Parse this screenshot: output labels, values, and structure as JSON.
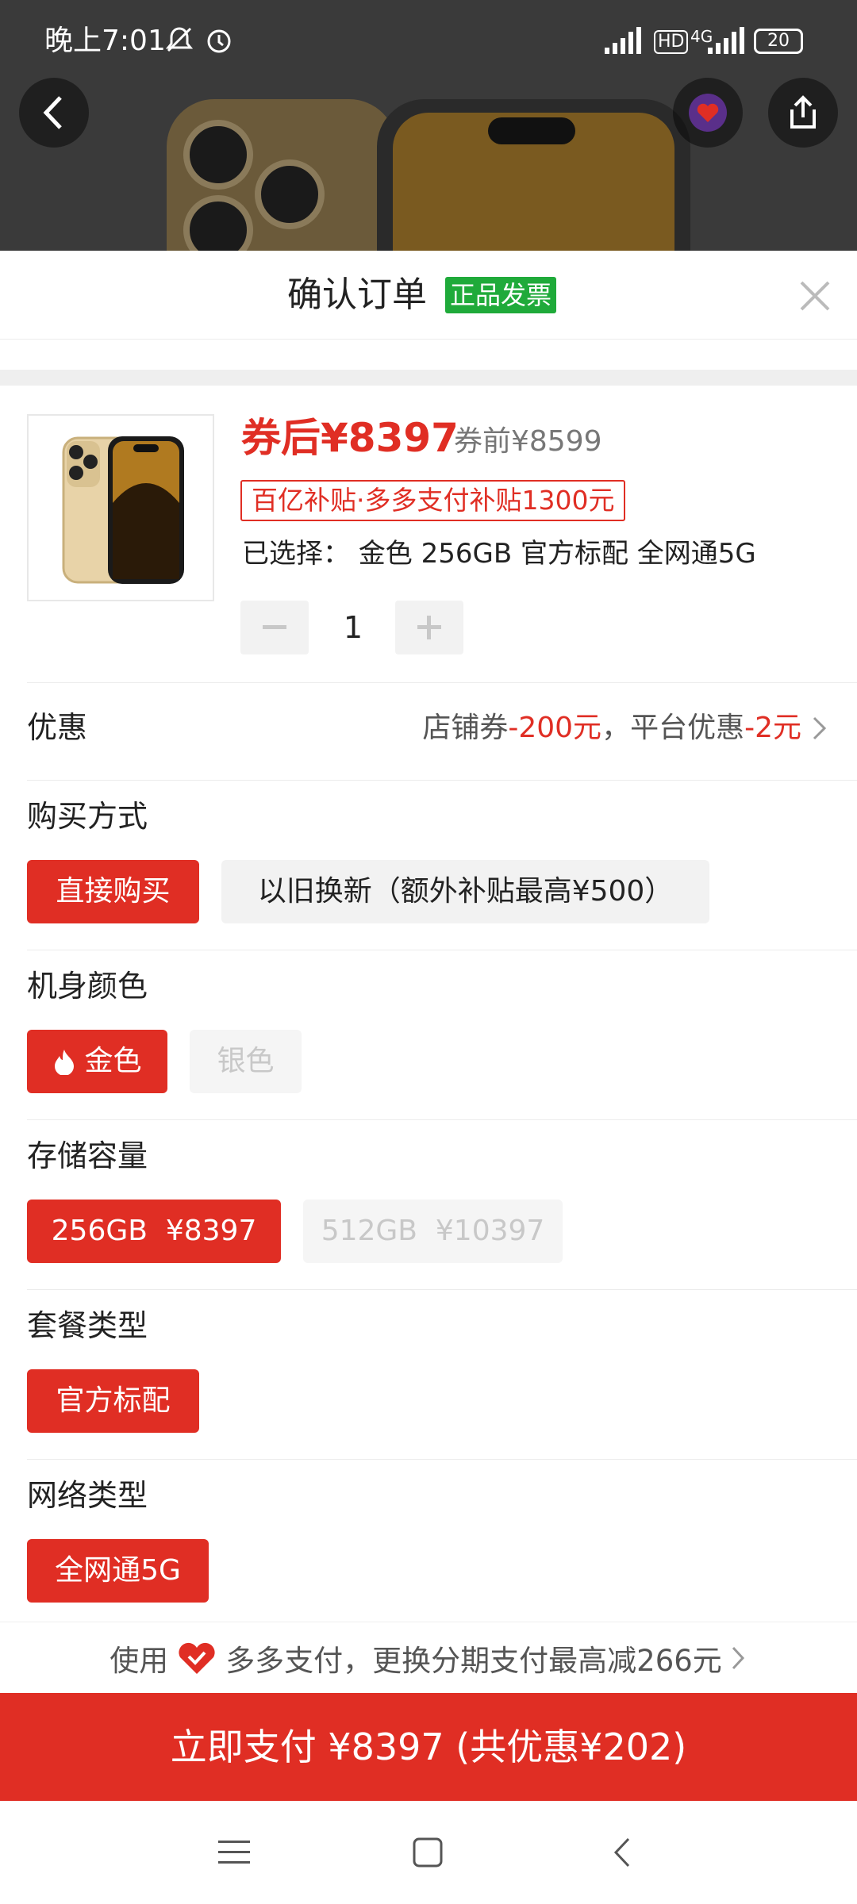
{
  "status_bar": {
    "time": "晚上7:01",
    "network": "4G",
    "hd": "HD",
    "battery": "20"
  },
  "header": {
    "title": "确认订单",
    "badge": "正品发票"
  },
  "product": {
    "price_after": "券后¥8397",
    "price_before": "券前¥8599",
    "subsidy_tag": "百亿补贴·多多支付补贴1300元",
    "selected": "已选择：  金色 256GB 官方标配 全网通5G",
    "quantity": "1"
  },
  "discount": {
    "label": "优惠",
    "shop_coupon_label": "店铺券",
    "shop_coupon_value": "-200元",
    "separator": "，",
    "platform_label": "平台优惠",
    "platform_value": "-2元"
  },
  "sections": {
    "purchase_method": {
      "title": "购买方式",
      "options": [
        "直接购买",
        "以旧换新（额外补贴最高¥500）"
      ]
    },
    "color": {
      "title": "机身颜色",
      "options": [
        "金色",
        "银色"
      ]
    },
    "storage": {
      "title": "存储容量",
      "options": [
        "256GB  ¥8397",
        "512GB  ¥10397"
      ]
    },
    "package": {
      "title": "套餐类型",
      "options": [
        "官方标配"
      ]
    },
    "network": {
      "title": "网络类型",
      "options": [
        "全网通5G"
      ]
    }
  },
  "payment": {
    "prefix": "使用",
    "text": "多多支付，更换分期支付最高减266元",
    "button": "立即支付 ¥8397 (共优惠¥202)"
  },
  "colors": {
    "accent": "#e02e24",
    "badge_green": "#1faa3a"
  }
}
